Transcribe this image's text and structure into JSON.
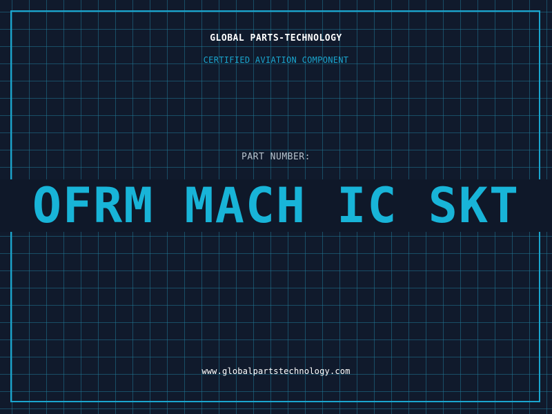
{
  "header": {
    "brand": "GLOBAL PARTS-TECHNOLOGY",
    "subtitle": "CERTIFIED AVIATION COMPONENT"
  },
  "part": {
    "label": "PART NUMBER:",
    "value": "OFRM MACH IC SKT"
  },
  "footer": {
    "url": "www.globalpartstechnology.com"
  },
  "colors": {
    "background": "#101a2c",
    "grid": "#2178a0",
    "accent": "#18b4d8",
    "text_primary": "#ffffff",
    "text_muted": "#b7c2cc"
  }
}
